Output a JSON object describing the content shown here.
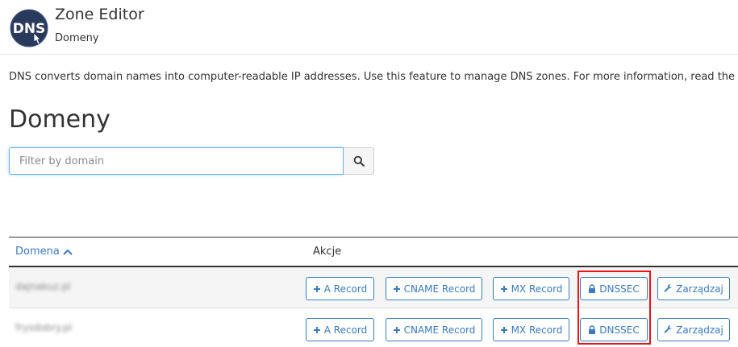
{
  "header": {
    "logo_text": "DNS",
    "title": "Zone Editor",
    "subtitle": "Domeny"
  },
  "description": "DNS converts domain names into computer-readable IP addresses. Use this feature to manage DNS zones. For more information, read the",
  "page_title": "Domeny",
  "search": {
    "placeholder": "Filter by domain",
    "value": ""
  },
  "table": {
    "col_domain": "Domena",
    "col_actions": "Akcje",
    "rows": [
      {
        "domain": "dajnakuz.pl"
      },
      {
        "domain": "frysdobry.pl"
      }
    ],
    "buttons": {
      "a_record": "A Record",
      "cname_record": "CNAME Record",
      "mx_record": "MX Record",
      "dnssec": "DNSSEC",
      "manage": "Zarządzaj"
    }
  },
  "colors": {
    "accent": "#3a7bbf",
    "highlight": "#e8141c",
    "logo_bg": "#2a3a5c"
  }
}
